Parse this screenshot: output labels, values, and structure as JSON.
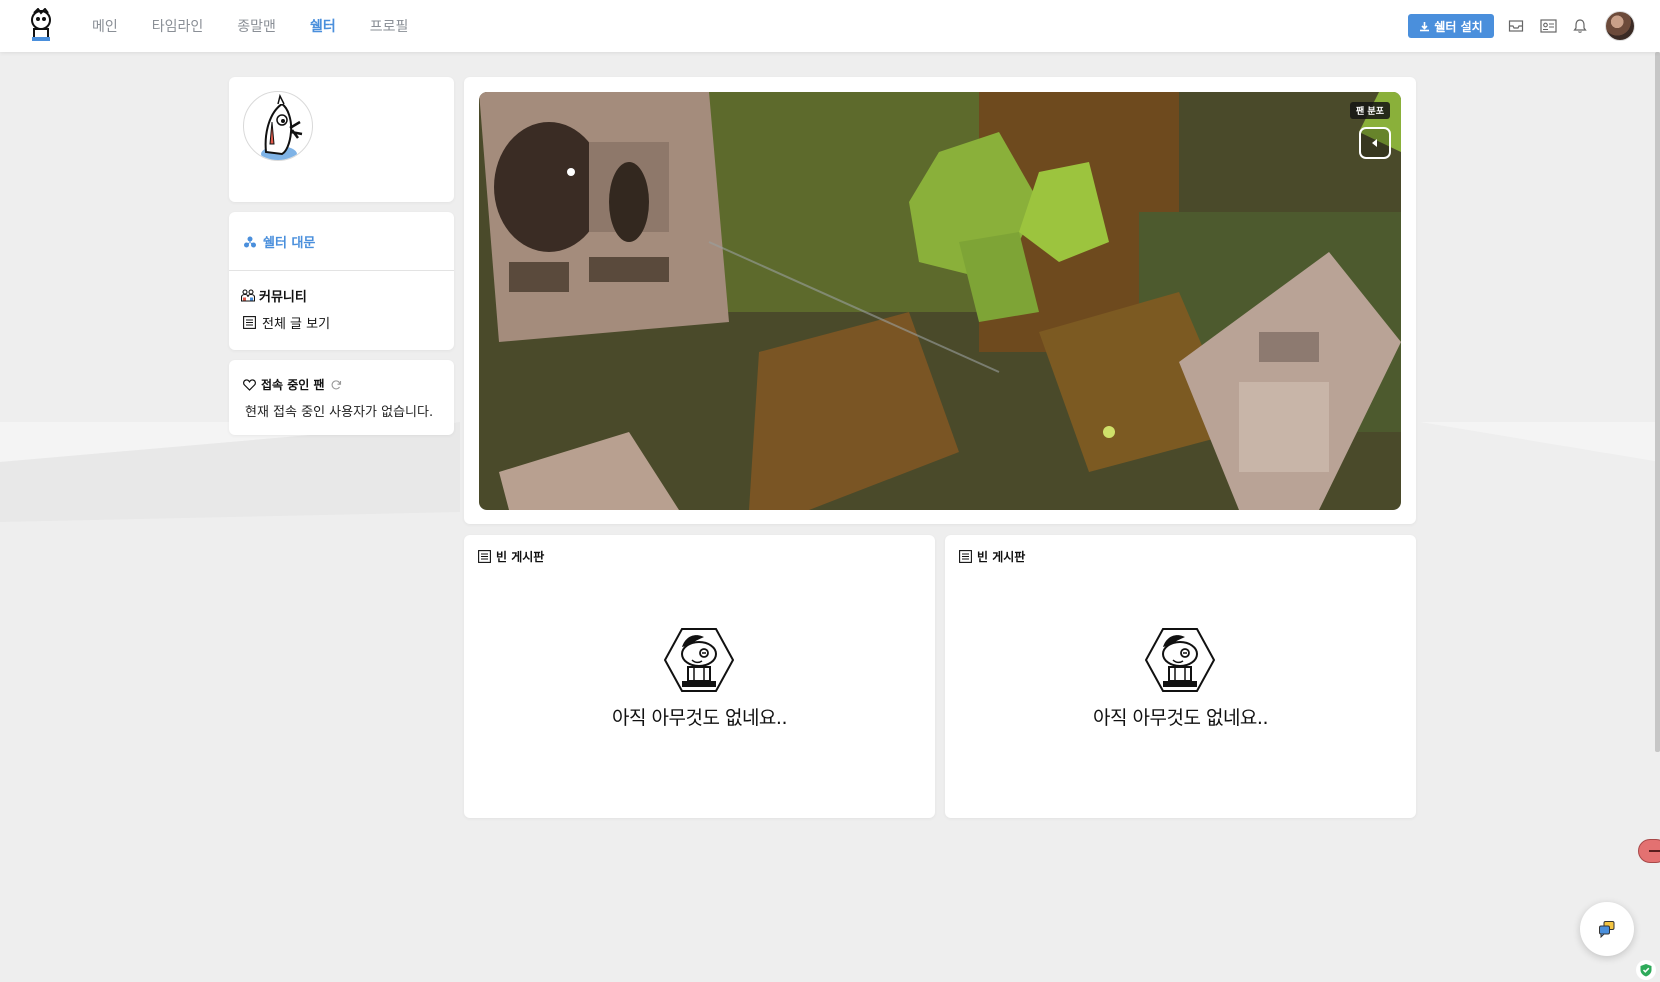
{
  "nav": {
    "items": [
      {
        "label": "메인",
        "active": false
      },
      {
        "label": "타임라인",
        "active": false
      },
      {
        "label": "종말맨",
        "active": false
      },
      {
        "label": "쉘터",
        "active": true
      },
      {
        "label": "프로필",
        "active": false
      }
    ],
    "install_label": "쉘터 설치",
    "icons": [
      "download-icon",
      "inbox-icon",
      "id-card-icon",
      "bell-icon"
    ]
  },
  "sidebar": {
    "main_label": "쉘터 대문",
    "community_title": "커뮤니티",
    "all_posts_label": "전체 글 보기",
    "online_title": "접속 중인 팬",
    "online_empty": "현재 접속 중인 사용자가 없습니다."
  },
  "banner": {
    "badge": "팬 분포"
  },
  "boards": [
    {
      "title": "빈 게시판",
      "empty_text": "아직 아무것도 없네요.."
    },
    {
      "title": "빈 게시판",
      "empty_text": "아직 아무것도 없네요.."
    }
  ],
  "colors": {
    "accent": "#4a8fdc",
    "background": "#eeeeee",
    "card": "#ffffff"
  }
}
